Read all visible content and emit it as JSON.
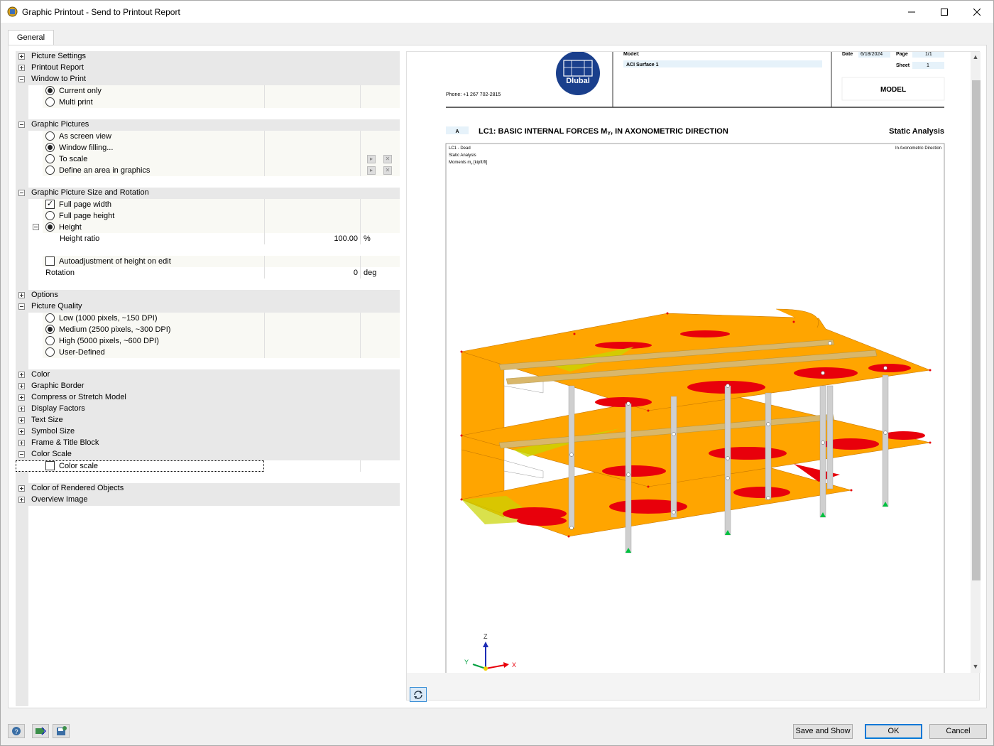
{
  "window": {
    "title": "Graphic Printout - Send to Printout Report",
    "minimize_glyph": "—",
    "maximize_glyph": "☐",
    "close_glyph": "✕"
  },
  "tabs": [
    {
      "label": "General",
      "active": true
    }
  ],
  "tree": {
    "picture_settings": "Picture Settings",
    "printout_report": "Printout Report",
    "window_to_print": {
      "label": "Window to Print",
      "options": [
        "Current only",
        "Multi print"
      ],
      "selected": "Current only"
    },
    "graphic_pictures": {
      "label": "Graphic Pictures",
      "options": [
        "As screen view",
        "Window filling...",
        "To scale",
        "Define an area in graphics"
      ],
      "selected": "Window filling..."
    },
    "size_rotation": {
      "label": "Graphic Picture Size and Rotation",
      "full_page_width": "Full page width",
      "full_page_width_checked": true,
      "full_page_height": "Full page height",
      "height": "Height",
      "height_ratio_label": "Height ratio",
      "height_ratio_value": "100.00",
      "height_ratio_unit": "%",
      "autoadjust": "Autoadjustment of height on edit",
      "autoadjust_checked": false,
      "rotation_label": "Rotation",
      "rotation_value": "0",
      "rotation_unit": "deg"
    },
    "options": "Options",
    "picture_quality": {
      "label": "Picture Quality",
      "options": [
        "Low (1000 pixels, ~150 DPI)",
        "Medium (2500 pixels, ~300 DPI)",
        "High (5000 pixels, ~600 DPI)",
        "User-Defined"
      ],
      "selected": "Medium (2500 pixels, ~300 DPI)"
    },
    "color": "Color",
    "graphic_border": "Graphic Border",
    "compress_stretch": "Compress or Stretch Model",
    "display_factors": "Display Factors",
    "text_size": "Text Size",
    "symbol_size": "Symbol Size",
    "frame_title_block": "Frame & Title Block",
    "color_scale": {
      "label": "Color Scale",
      "item": "Color scale",
      "checked": false
    },
    "color_rendered": "Color of Rendered Objects",
    "overview_image": "Overview Image"
  },
  "preview": {
    "logo_text": "Dlubal",
    "phone": "Phone: +1 267 702-2815",
    "model_label": "Model:",
    "model_value": "ACI Surface 1",
    "date_label": "Date",
    "date_value": "6/18/2024",
    "page_label": "Page",
    "page_value": "1/1",
    "sheet_label": "Sheet",
    "sheet_value": "1",
    "block_title": "MODEL",
    "section_letter": "A",
    "section_title": "LC1: BASIC INTERNAL FORCES M",
    "section_title_sub": "Y",
    "section_title_tail": ", IN AXONOMETRIC DIRECTION",
    "section_right": "Static Analysis",
    "info_line1": "LC1 - Dead",
    "info_line2": "Static Analysis",
    "info_line3": "Moments m",
    "info_line3_sub": "y",
    "info_line3_tail": " [kipft/ft]",
    "direction": "In Axonometric Direction",
    "axis_x": "X",
    "axis_y": "Y",
    "axis_z": "Z"
  },
  "buttons": {
    "save_and_show": "Save and Show",
    "ok": "OK",
    "cancel": "Cancel"
  },
  "colors": {
    "slab": "#ffa500",
    "hot": "#e8000b",
    "accent": "#0078d7",
    "logo": "#1a3f8c"
  }
}
